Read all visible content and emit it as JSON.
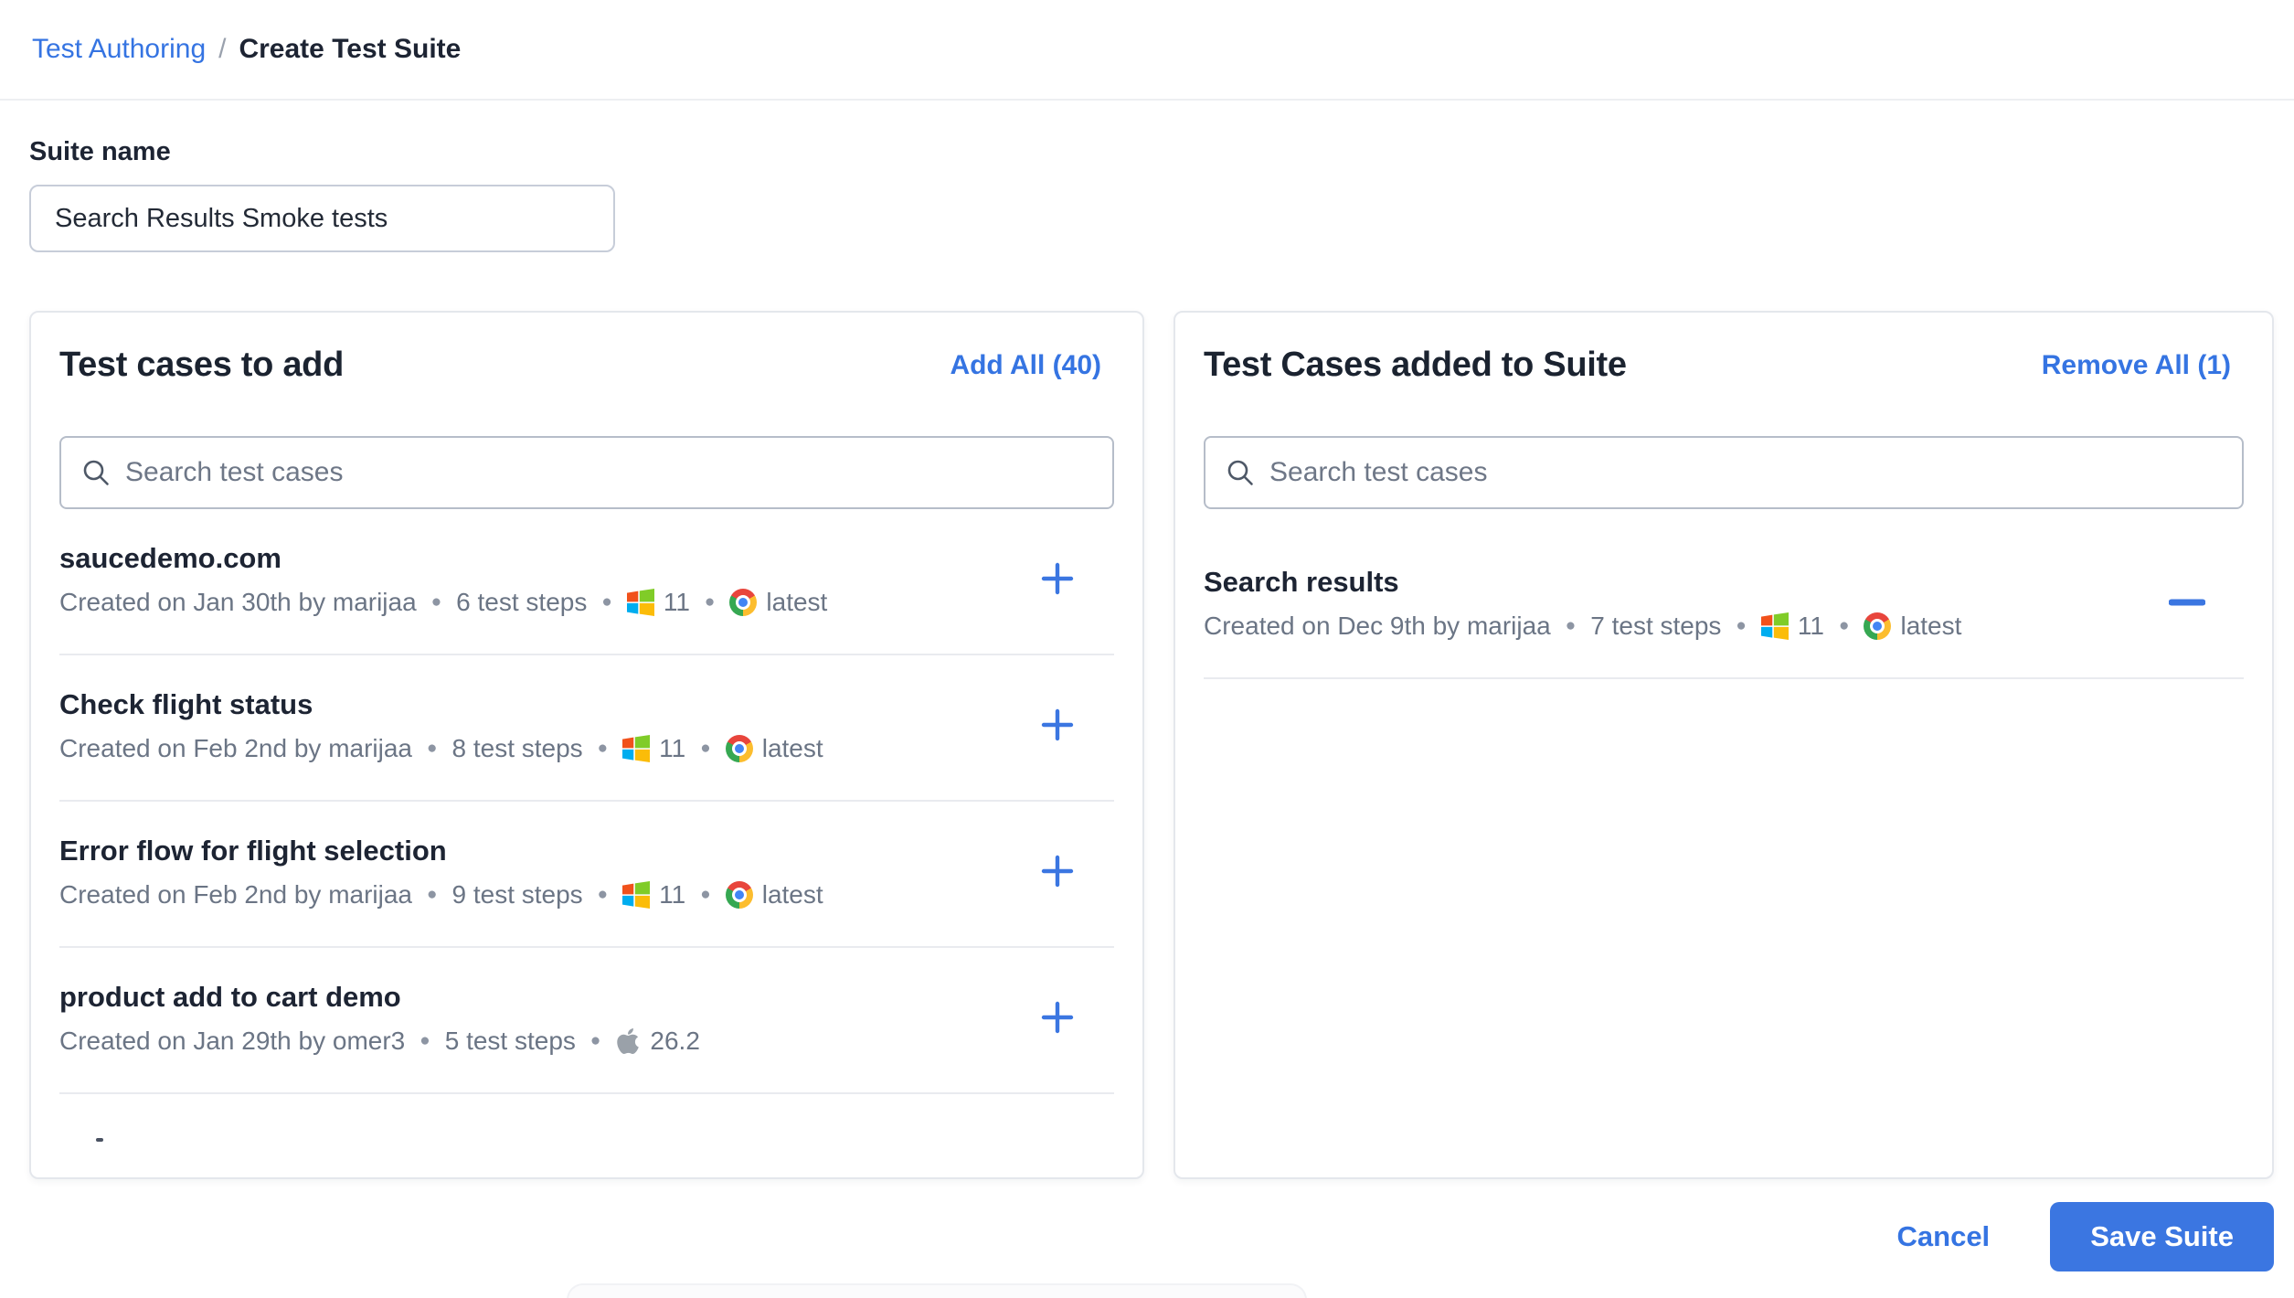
{
  "accent": "#3574e2",
  "breadcrumb": {
    "parent": "Test Authoring",
    "separator": "/",
    "current": "Create Test Suite"
  },
  "suite_name": {
    "label": "Suite name",
    "value": "Search Results Smoke tests"
  },
  "left_panel": {
    "title": "Test cases to add",
    "action_label": "Add All (40)",
    "search_placeholder": "Search test cases",
    "rows": [
      {
        "title": "saucedemo.com",
        "created": "Created on Jan 30th by marijaa",
        "steps": "6 test steps",
        "os_icon": "windows-icon",
        "os_version": "11",
        "browser_icon": "chrome-icon",
        "browser_version": "latest"
      },
      {
        "title": "Check flight status",
        "created": "Created on Feb 2nd by marijaa",
        "steps": "8 test steps",
        "os_icon": "windows-icon",
        "os_version": "11",
        "browser_icon": "chrome-icon",
        "browser_version": "latest"
      },
      {
        "title": "Error flow for flight selection",
        "created": "Created on Feb 2nd by marijaa",
        "steps": "9 test steps",
        "os_icon": "windows-icon",
        "os_version": "11",
        "browser_icon": "chrome-icon",
        "browser_version": "latest"
      },
      {
        "title": "product add to cart demo",
        "created": "Created on Jan 29th by omer3",
        "steps": "5 test steps",
        "os_icon": "apple-icon",
        "os_version": "26.2",
        "browser_icon": "",
        "browser_version": ""
      }
    ]
  },
  "right_panel": {
    "title": "Test Cases added to Suite",
    "action_label": "Remove All (1)",
    "search_placeholder": "Search test cases",
    "rows": [
      {
        "title": "Search results",
        "created": "Created on Dec 9th by marijaa",
        "steps": "7 test steps",
        "os_icon": "windows-icon",
        "os_version": "11",
        "browser_icon": "chrome-icon",
        "browser_version": "latest"
      }
    ]
  },
  "footer": {
    "cancel_label": "Cancel",
    "save_label": "Save Suite"
  }
}
